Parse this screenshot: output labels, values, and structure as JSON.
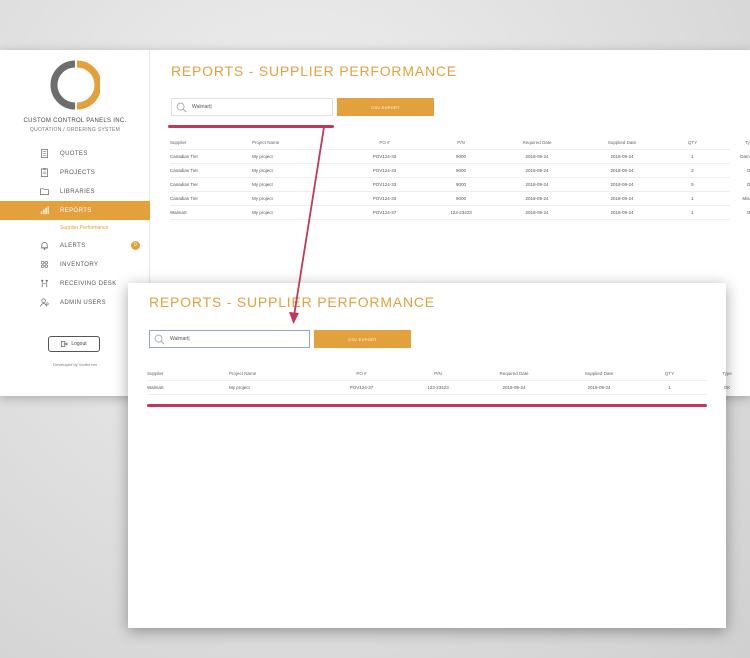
{
  "colors": {
    "accent": "#e3a13d",
    "annotation": "#c2385a"
  },
  "sidebar": {
    "company": "CUSTOM CONTROL PANELS INC.",
    "subtitle": "QUOTATION / ORDERING SYSTEM",
    "items": [
      {
        "label": "QUOTES",
        "icon": "document-icon"
      },
      {
        "label": "PROJECTS",
        "icon": "clipboard-icon"
      },
      {
        "label": "LIBRARIES",
        "icon": "folder-icon"
      },
      {
        "label": "REPORTS",
        "icon": "bar-chart-icon",
        "active": true
      },
      {
        "label": "ALERTS",
        "icon": "bell-icon",
        "badge": "0"
      },
      {
        "label": "INVENTORY",
        "icon": "inventory-icon"
      },
      {
        "label": "RECEIVING DESK",
        "icon": "receiving-icon"
      },
      {
        "label": "ADMIN USERS",
        "icon": "users-icon"
      }
    ],
    "sub_item": "Supplier Performance",
    "logout": "Logout",
    "developed_by": "Developed by Vortex.net"
  },
  "back": {
    "title": "REPORTS - SUPPLIER PERFORMANCE",
    "search_value": "Walmart|",
    "csv_label": "CSV EXPORT",
    "headers": [
      "Supplier",
      "Project Name",
      "PO #",
      "P/N",
      "Required Date",
      "Supplied Date",
      "QTY",
      "Type"
    ],
    "rows": [
      [
        "Canadian Tier",
        "My project",
        "POV124-33",
        "9000",
        "2018-09-24",
        "2018-09-24",
        "1",
        "Damaged"
      ],
      [
        "Canadian Tier",
        "My project",
        "POV124-33",
        "9000",
        "2018-09-24",
        "2018-09-24",
        "2",
        "OK"
      ],
      [
        "Canadian Tier",
        "My project",
        "POV124-33",
        "9000",
        "2018-09-24",
        "2018-09-24",
        "5",
        "OK"
      ],
      [
        "Canadian Tier",
        "My project",
        "POV124-33",
        "9000",
        "2018-09-24",
        "2018-09-24",
        "1",
        "Missing"
      ],
      [
        "Walmart",
        "My project",
        "POV124-37",
        "123-23423",
        "2018-09-24",
        "2018-09-24",
        "1",
        "OK"
      ]
    ]
  },
  "front": {
    "title": "REPORTS - SUPPLIER PERFORMANCE",
    "search_value": "Walmart|",
    "csv_label": "CSV EXPORT",
    "headers": [
      "Supplier",
      "Project Name",
      "PO #",
      "P/N",
      "Required Date",
      "Supplied Date",
      "QTY",
      "Type"
    ],
    "rows": [
      [
        "Walmart",
        "My project",
        "POV124-37",
        "123-23423",
        "2018-09-24",
        "2018-09-24",
        "1",
        "OK"
      ]
    ]
  }
}
